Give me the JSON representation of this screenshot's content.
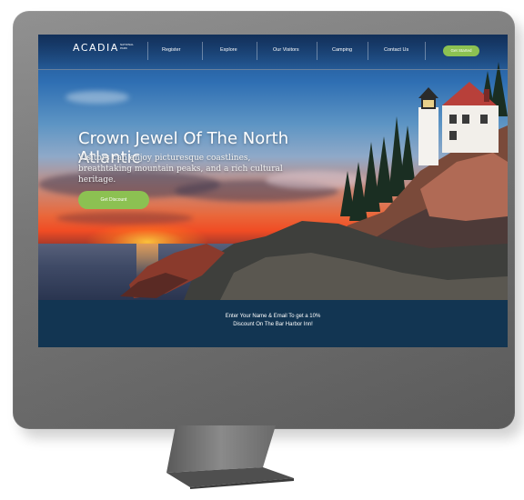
{
  "site": {
    "logo": "ACADIA",
    "logo_sub": "NATIONAL PARK"
  },
  "nav": {
    "items": [
      "Register",
      "Explore",
      "Our Visitors",
      "Camping",
      "Contact Us"
    ],
    "button_label": "Get Started"
  },
  "hero": {
    "headline": "Crown Jewel Of The North Atlantic",
    "subtext": "Visitors can enjoy picturesque coastlines, breathtaking mountain peaks, and a rich cultural heritage.",
    "cta_label": "Get Discount"
  },
  "footer": {
    "line1": "Enter Your Name & Email To get a 10%",
    "line2": "Discount On The Bar Harbor Inn!"
  },
  "colors": {
    "accent": "#8cc152",
    "footer_bg": "#123552",
    "bezel": "#707070"
  },
  "icons": [
    "lighthouse-illustration"
  ]
}
